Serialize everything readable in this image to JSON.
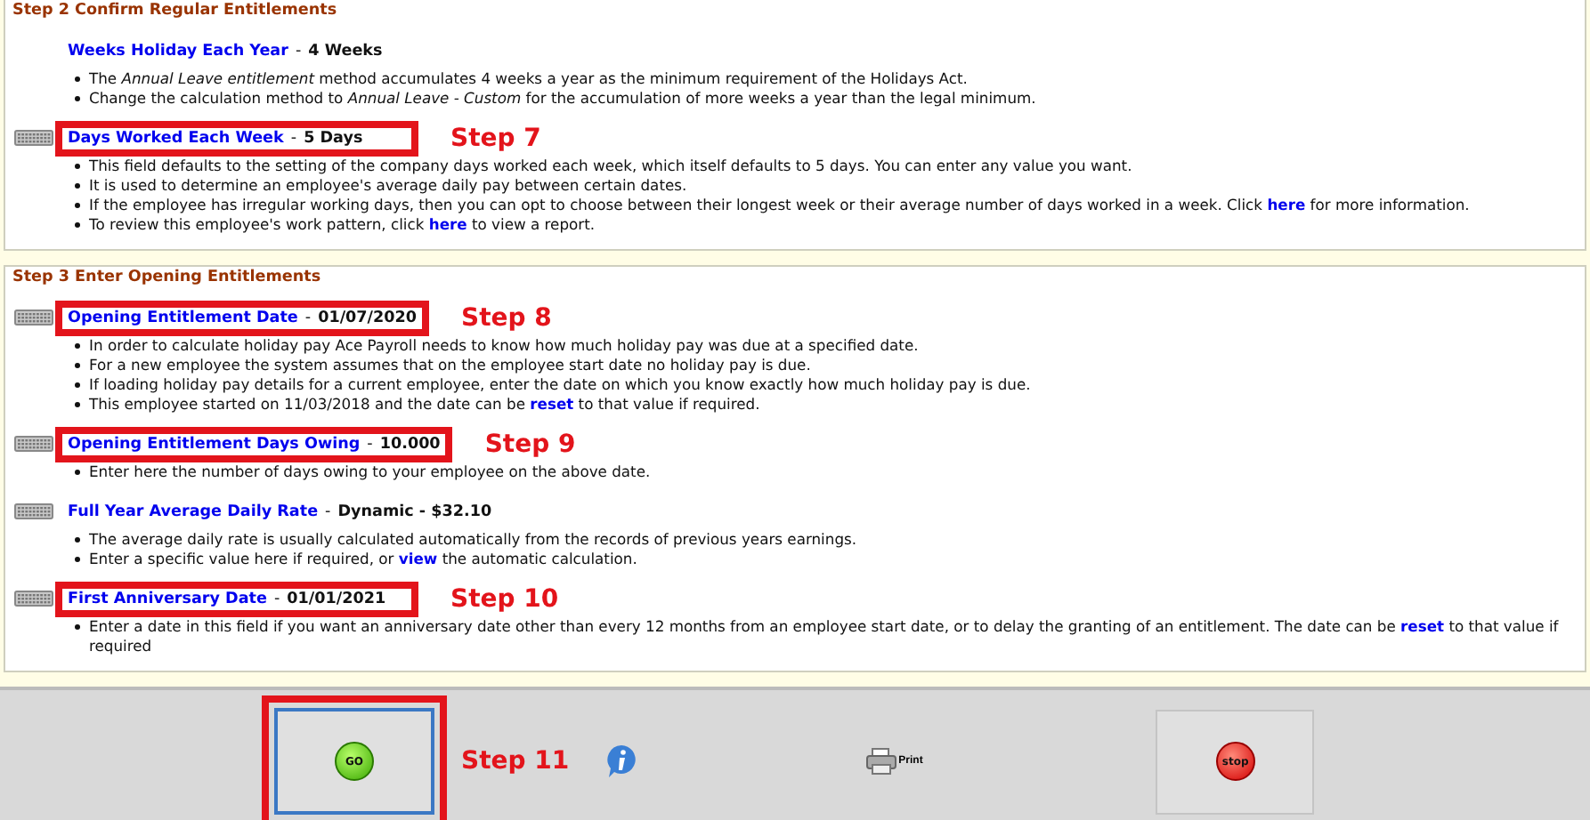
{
  "sections": [
    {
      "heading": "Step 2 Confirm Regular Entitlements",
      "items": [
        {
          "keyboard_icon": false,
          "title": "Weeks Holiday Each Year",
          "separator": "-",
          "value": "4 Weeks",
          "highlighted": false,
          "bullets": [
            [
              {
                "text": "The "
              },
              {
                "text": "Annual Leave entitlement",
                "kind": "em"
              },
              {
                "text": " method accumulates 4 weeks a year as the minimum requirement of the Holidays Act."
              }
            ],
            [
              {
                "text": "Change the calculation method to "
              },
              {
                "text": "Annual Leave - Custom",
                "kind": "em"
              },
              {
                "text": " for the accumulation of more weeks a year than the legal minimum."
              }
            ]
          ]
        },
        {
          "keyboard_icon": true,
          "title": "Days Worked Each Week",
          "separator": "-",
          "value": "5 Days",
          "highlighted": true,
          "step": "Step 7",
          "bullets": [
            [
              {
                "text": "This field defaults to the setting of the company days worked each week, which itself defaults to 5 days. You can enter any value you want."
              }
            ],
            [
              {
                "text": "It is used to determine an employee's average daily pay between certain dates."
              }
            ],
            [
              {
                "text": "If the employee has irregular working days, then you can opt to choose between their longest week or their average number of days worked in a week. Click "
              },
              {
                "text": "here",
                "kind": "link"
              },
              {
                "text": " for more information."
              }
            ],
            [
              {
                "text": "To review this employee's work pattern, click "
              },
              {
                "text": "here",
                "kind": "link"
              },
              {
                "text": " to view a report."
              }
            ]
          ]
        }
      ]
    },
    {
      "heading": "Step 3 Enter Opening Entitlements",
      "items": [
        {
          "keyboard_icon": true,
          "title": "Opening Entitlement Date",
          "separator": "-",
          "value": "01/07/2020",
          "highlighted": true,
          "step": "Step 8",
          "bullets": [
            [
              {
                "text": "In order to calculate holiday pay Ace Payroll needs to know how much holiday pay was due at a specified date."
              }
            ],
            [
              {
                "text": "For a new employee the system assumes that on the employee start date no holiday pay is due."
              }
            ],
            [
              {
                "text": "If loading holiday pay details for a current employee, enter the date on which you know exactly how much holiday pay is due."
              }
            ],
            [
              {
                "text": "This employee started on 11/03/2018 and the date can be "
              },
              {
                "text": "reset",
                "kind": "link"
              },
              {
                "text": " to that value if required."
              }
            ]
          ]
        },
        {
          "keyboard_icon": true,
          "title": "Opening Entitlement Days Owing",
          "separator": "-",
          "value": "10.000",
          "highlighted": true,
          "step": "Step 9",
          "bullets": [
            [
              {
                "text": "Enter here the number of days owing to your employee on the above date."
              }
            ]
          ]
        },
        {
          "keyboard_icon": true,
          "title": "Full Year Average Daily Rate",
          "separator": "-",
          "value": "Dynamic - $32.10",
          "highlighted": false,
          "bullets": [
            [
              {
                "text": "The average daily rate is usually calculated automatically from the records of previous years earnings."
              }
            ],
            [
              {
                "text": "Enter a specific value here if required, or "
              },
              {
                "text": "view",
                "kind": "link"
              },
              {
                "text": " the automatic calculation."
              }
            ]
          ]
        },
        {
          "keyboard_icon": true,
          "title": "First Anniversary Date",
          "separator": "-",
          "value": "01/01/2021",
          "highlighted": true,
          "step": "Step 10",
          "bullets": [
            [
              {
                "text": "Enter a date in this field if you want an anniversary date other than every 12 months from an employee start date, or to delay the granting of an entitlement. The date can be "
              },
              {
                "text": "reset",
                "kind": "link"
              },
              {
                "text": " to that value if required"
              }
            ]
          ]
        }
      ]
    }
  ],
  "footer": {
    "go": {
      "label": "GO",
      "highlighted": true,
      "step": "Step 11"
    },
    "print": "Print",
    "stop": "stop"
  }
}
